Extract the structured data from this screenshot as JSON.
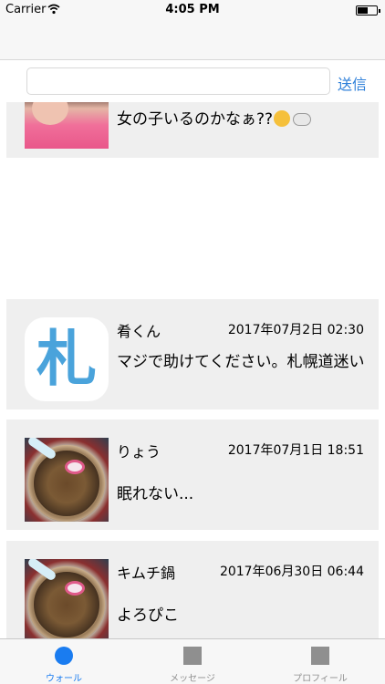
{
  "status_bar": {
    "carrier": "Carrier",
    "time": "4:05 PM",
    "wifi_icon": "wifi-icon",
    "battery_icon": "battery-icon"
  },
  "compose": {
    "input_value": "",
    "input_placeholder": "",
    "send_label": "送信"
  },
  "posts": [
    {
      "name": "",
      "date": "",
      "message": "女の子いるのかなぁ??",
      "avatar": "girl-photo",
      "emoji": [
        "thinking-face-icon",
        "thought-balloon-icon"
      ]
    },
    {
      "name": "肴くん",
      "date": "2017年07月2日 02:30",
      "message": "マジで助けてください。札幌道迷い",
      "avatar": "sapporo-app-icon",
      "avatar_glyph": "札"
    },
    {
      "name": "りょう",
      "date": "2017年07月1日 18:51",
      "message": "眠れない...",
      "avatar": "ramen-photo"
    },
    {
      "name": "キムチ鍋",
      "date": "2017年06月30日 06:44",
      "message": "よろぴこ",
      "avatar": "ramen-photo"
    }
  ],
  "tabs": [
    {
      "label": "ウォール",
      "icon": "circle-icon",
      "selected": true,
      "color": "#1a7cf0"
    },
    {
      "label": "メッセージ",
      "icon": "square-icon",
      "selected": false,
      "color": "#8f8f8f"
    },
    {
      "label": "プロフィール",
      "icon": "square-icon",
      "selected": false,
      "color": "#8f8f8f"
    }
  ],
  "colors": {
    "accent": "#2d7fd9",
    "card_background": "#efefef",
    "tab_selected": "#1a7cf0",
    "tab_unselected": "#8f8f8f"
  }
}
